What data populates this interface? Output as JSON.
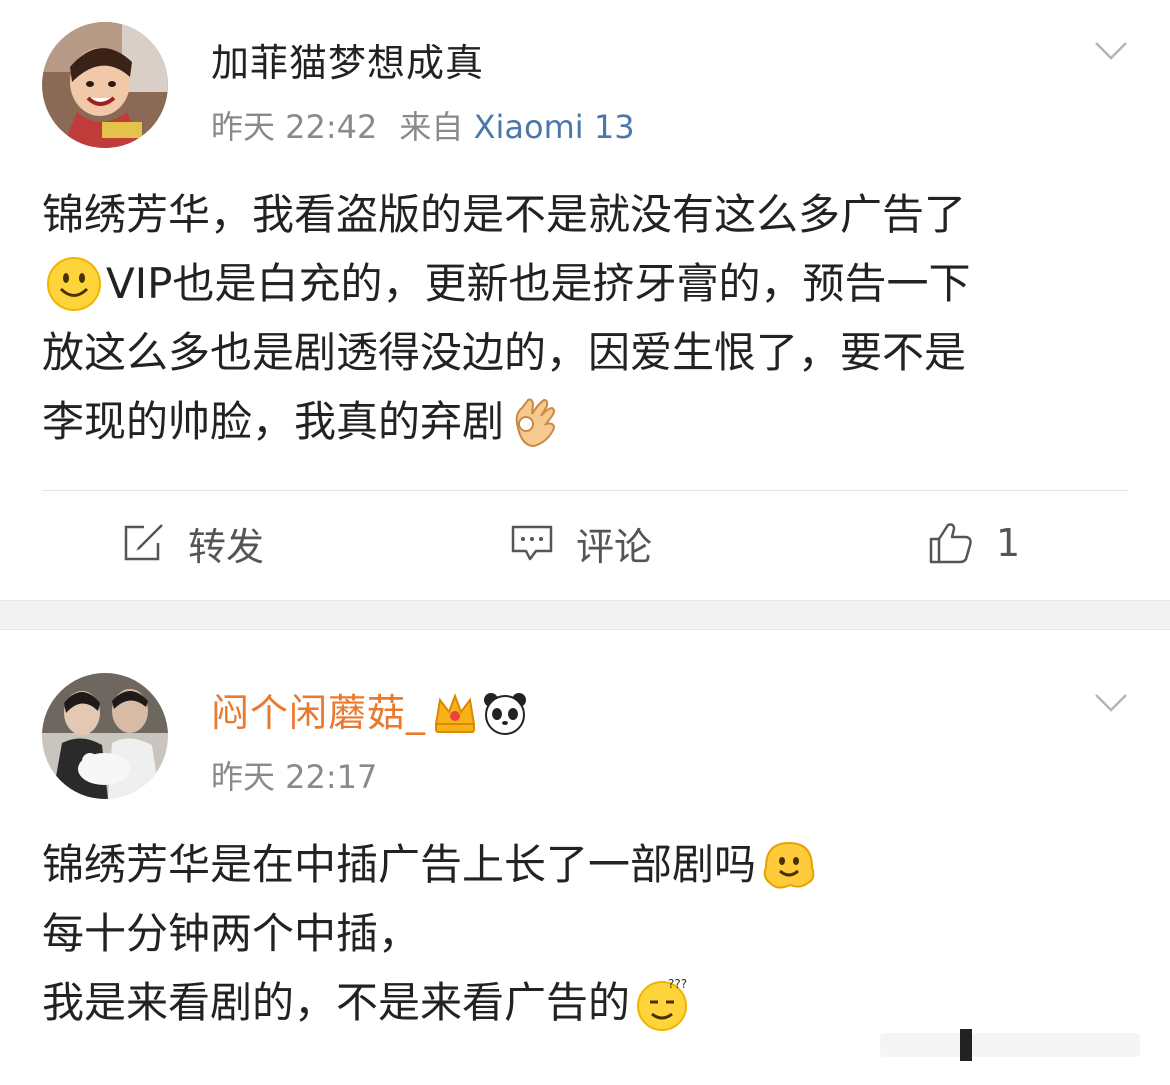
{
  "posts": [
    {
      "username": "加菲猫梦想成真",
      "time": "昨天 22:42",
      "source_prefix": "来自",
      "source": "Xiaomi 13",
      "lines": [
        "锦绣芳华，我看盗版的是不是就没有这么多广告了",
        "VIP也是白充的，更新也是挤牙膏的，预告一下",
        "放这么多也是剧透得没边的，因爱生恨了，要不是",
        "李现的帅脸，我真的弃剧"
      ],
      "actions": {
        "repost_label": "转发",
        "comment_label": "评论",
        "like_count": "1"
      },
      "icons": [
        "smile-emoji",
        "ok-hand-emoji"
      ]
    },
    {
      "username": "闷个闲蘑菇_",
      "time": "昨天 22:17",
      "lines": [
        "锦绣芳华是在中插广告上长了一部剧吗",
        "每十分钟两个中插，",
        "我是来看剧的，不是来看广告的"
      ],
      "icons": [
        "crown-badge",
        "panda-badge",
        "melting-face-emoji",
        "confused-sweat-emoji"
      ]
    }
  ],
  "colors": {
    "username_vip": "#e8792f",
    "source_link": "#4b78a9",
    "meta": "#8a8a8a",
    "separator": "#f2f2f2"
  }
}
